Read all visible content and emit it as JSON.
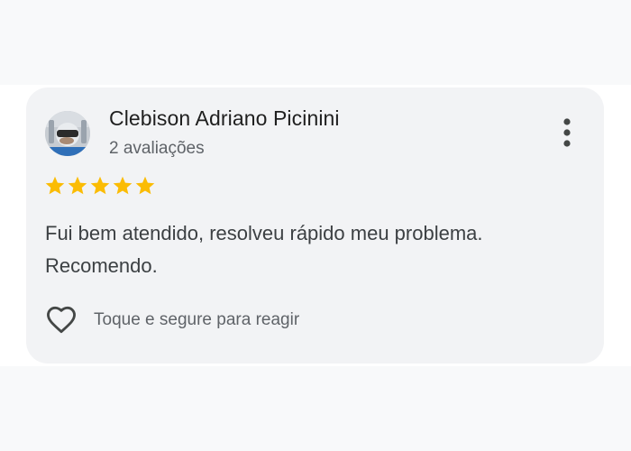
{
  "review": {
    "reviewer_name": "Clebison Adriano Picinini",
    "review_count": "2 avaliações",
    "rating": 5,
    "max_rating": 5,
    "text": "Fui bem atendido, resolveu rápido meu problema. Recomendo.",
    "react_label": "Toque e segure para reagir"
  },
  "icons": {
    "avatar": "reviewer-avatar",
    "more": "more-vert-icon",
    "star": "star-icon",
    "heart": "heart-outline-icon"
  },
  "colors": {
    "star": "#fbbc04",
    "card_background": "#f2f3f5",
    "page_band": "#f8f9fa",
    "name_text": "#1f1f1f",
    "secondary_text": "#5f6368",
    "body_text": "#3c4043",
    "icon": "#444746"
  }
}
